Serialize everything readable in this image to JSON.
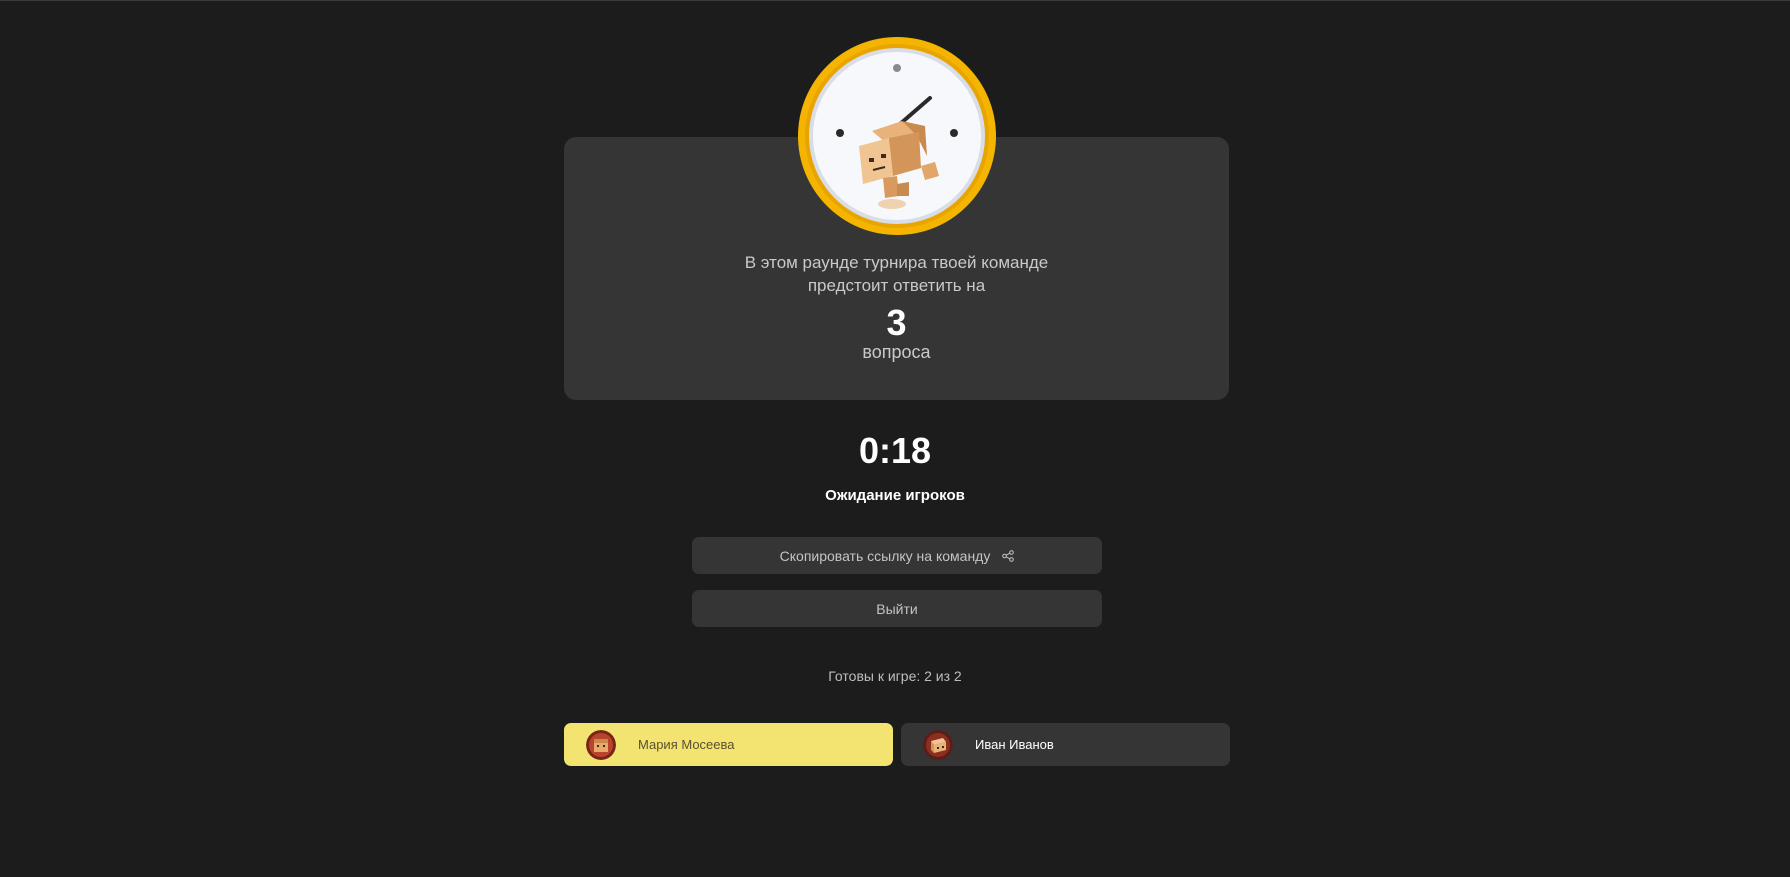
{
  "round_info": {
    "line1": "В этом раунде турнира твоей команде",
    "line2": "предстоит ответить на",
    "question_count": "3",
    "question_word": "вопроса"
  },
  "timer": "0:18",
  "status": "Ожидание игроков",
  "buttons": {
    "copy_link": "Скопировать ссылку на команду",
    "exit": "Выйти"
  },
  "ready_status": "Готовы к игре: 2 из 2",
  "players": [
    {
      "name": "Мария Мосеева",
      "highlighted": true
    },
    {
      "name": "Иван Иванов",
      "highlighted": false
    }
  ],
  "colors": {
    "background": "#1c1c1c",
    "card": "#353535",
    "highlight": "#f3e370",
    "clock_rim": "#f5b800"
  }
}
